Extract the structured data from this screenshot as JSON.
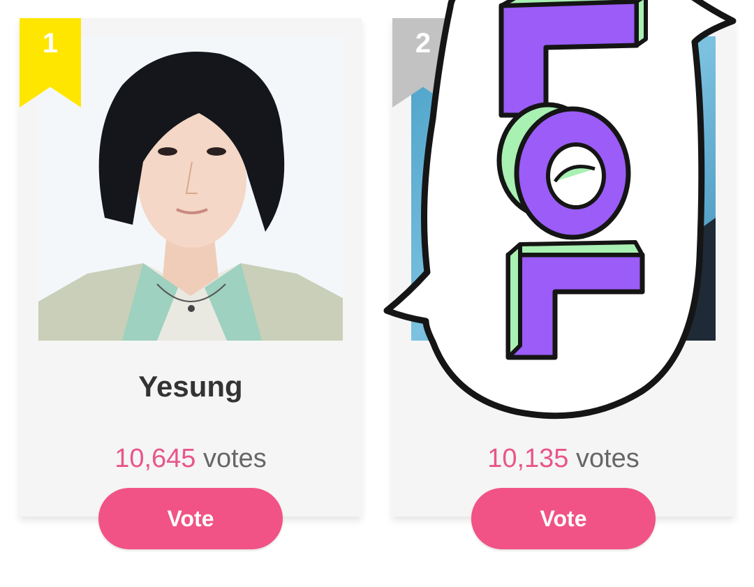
{
  "cards": [
    {
      "rank": "1",
      "name": "Yesung",
      "vote_count": "10,645",
      "votes_suffix": "votes",
      "vote_button_label": "Vote",
      "ribbon_color": "#ffe600"
    },
    {
      "rank": "2",
      "name": "",
      "vote_count": "10,135",
      "votes_suffix": "votes",
      "vote_button_label": "Vote",
      "ribbon_color": "#c2c2c2"
    }
  ],
  "sticker": {
    "text": "LOL",
    "letter_color": "#9b5cf7",
    "side_color": "#a9f0b3"
  },
  "colors": {
    "accent": "#f15386",
    "count_text": "#e8558a",
    "card_bg": "#f5f5f5"
  }
}
